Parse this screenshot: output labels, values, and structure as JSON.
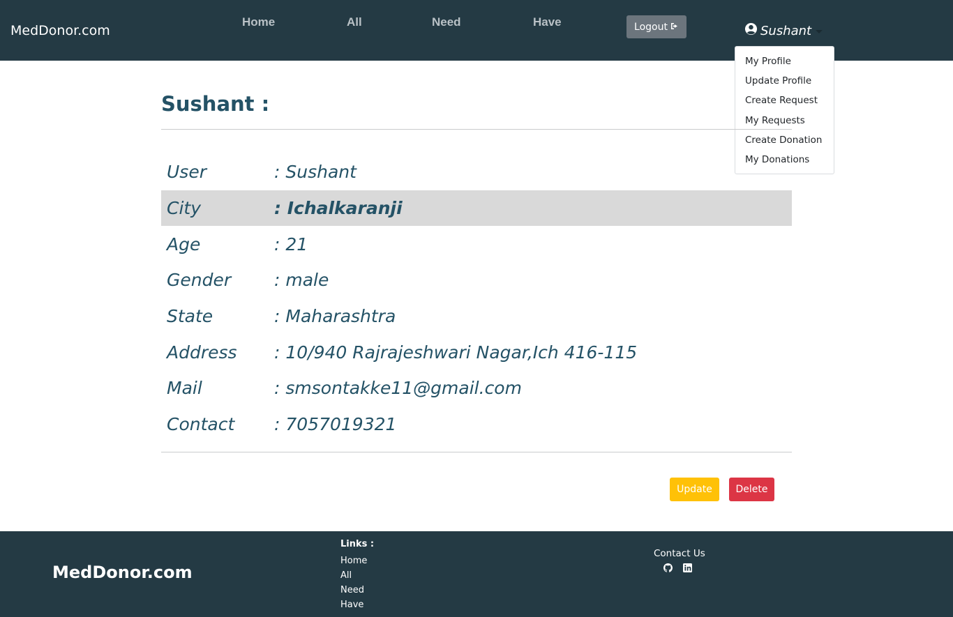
{
  "nav": {
    "brand": "MedDonor.com",
    "links": [
      "Home",
      "All",
      "Need",
      "Have"
    ],
    "logout_label": "Logout",
    "user_name": "Sushant"
  },
  "dropdown": {
    "items": [
      "My Profile",
      "Update Profile",
      "Create Request",
      "My Requests",
      "Create Donation",
      "My Donations"
    ]
  },
  "profile": {
    "title": "Sushant :",
    "rows": [
      {
        "label": "User",
        "value": ": Sushant"
      },
      {
        "label": "City",
        "value": ": Ichalkaranji"
      },
      {
        "label": "Age",
        "value": ": 21"
      },
      {
        "label": "Gender",
        "value": ": male"
      },
      {
        "label": "State",
        "value": ": Maharashtra"
      },
      {
        "label": "Address",
        "value": ": 10/940 Rajrajeshwari Nagar,Ich 416-115"
      },
      {
        "label": "Mail",
        "value": ": smsontakke11@gmail.com"
      },
      {
        "label": "Contact",
        "value": ": 7057019321"
      }
    ],
    "update_label": "Update",
    "delete_label": "Delete"
  },
  "footer": {
    "brand": "MedDonor.com",
    "links_title": "Links :",
    "links": [
      "Home",
      "All",
      "Need",
      "Have"
    ],
    "contact_title": "Contact Us",
    "social_icons": [
      "github-icon",
      "linkedin-icon"
    ]
  },
  "colors": {
    "nav_bg": "#243a44",
    "accent_text": "#245266",
    "highlight_row": "#d9d9d9",
    "update": "#ffc107",
    "delete": "#dc3545",
    "logout": "#6c757d"
  }
}
